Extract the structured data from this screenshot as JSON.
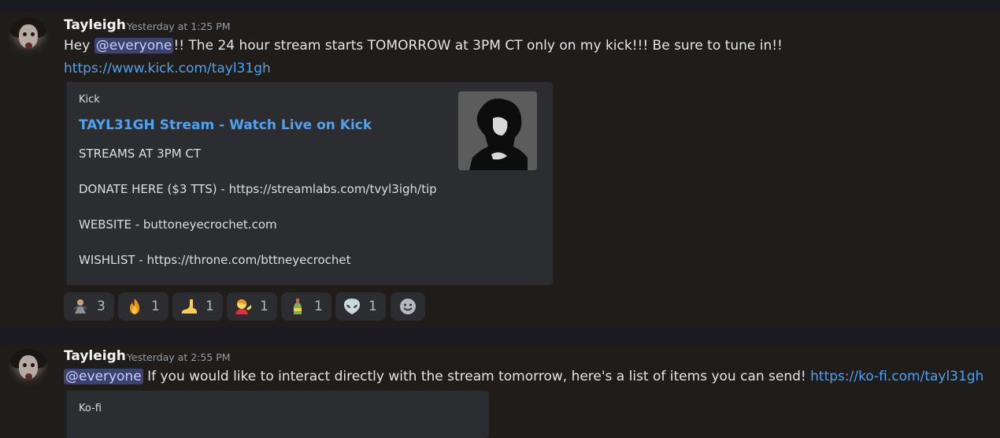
{
  "messages": [
    {
      "username": "Tayleigh",
      "timestamp": "Yesterday at 1:25 PM",
      "text_before": "Hey ",
      "mention": "@everyone",
      "text_after": "!! The 24 hour stream starts TOMORROW at 3PM CT only on my kick!!! Be sure to tune in!!",
      "link": "https://www.kick.com/tayl31gh",
      "embed": {
        "provider": "Kick",
        "title": "TAYL31GH Stream - Watch Live on Kick",
        "lines": [
          "STREAMS AT 3PM CT",
          "DONATE HERE ($3 TTS) - https://streamlabs.com/tvyl3igh/tip",
          "WEBSITE - buttoneyecrochet.com",
          "WISHLIST - https://throne.com/bttneyecrochet"
        ]
      },
      "reactions": [
        {
          "emoji": "figure-emoji",
          "count": "3"
        },
        {
          "emoji": "fire-emoji",
          "count": "1"
        },
        {
          "emoji": "foot-emoji",
          "count": "1"
        },
        {
          "emoji": "person-emoji",
          "count": "1"
        },
        {
          "emoji": "bottle-emoji",
          "count": "1"
        },
        {
          "emoji": "alien-emoji",
          "count": "1"
        }
      ]
    },
    {
      "username": "Tayleigh",
      "timestamp": "Yesterday at 2:55 PM",
      "mention": "@everyone",
      "text_after": " If you would like to interact directly with the stream tomorrow, here's a list of items you can send! ",
      "link": "https://ko-fi.com/tayl31gh",
      "embed": {
        "provider": "Ko-fi"
      }
    }
  ],
  "colors": {
    "background": "#1f1c19",
    "embed": "#2b2d31",
    "link": "#4ea2f0",
    "mention": "#3c4270"
  }
}
